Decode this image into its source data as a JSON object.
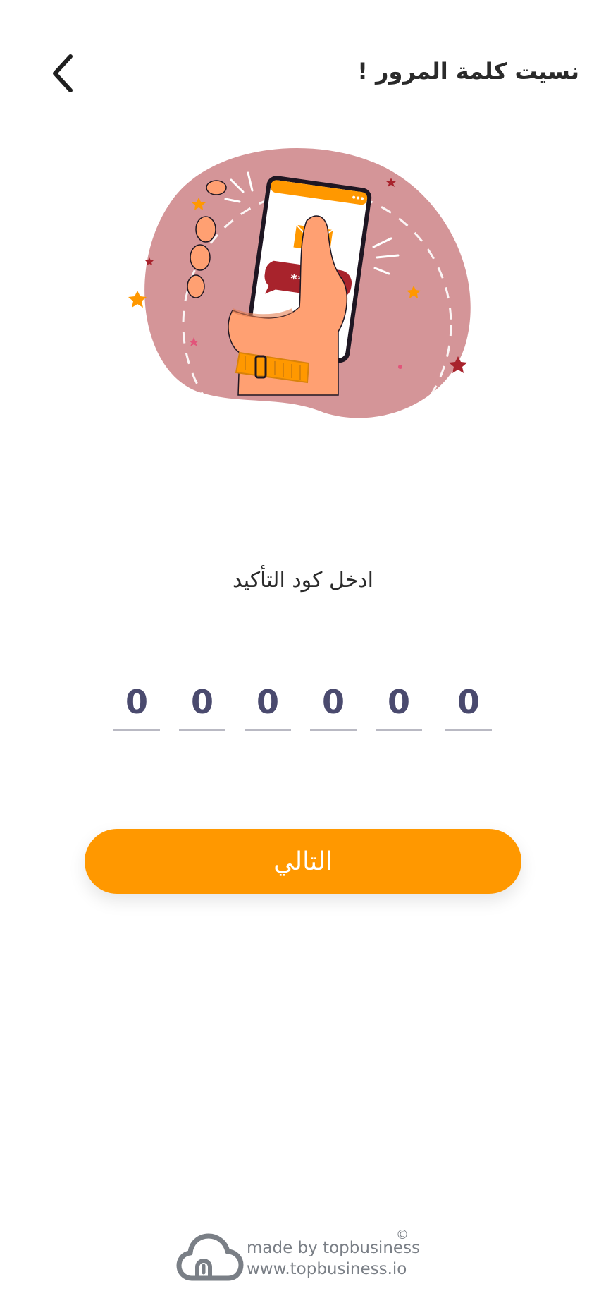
{
  "header": {
    "title": "نسيت كلمة المرور !",
    "back_icon": "chevron-left-icon"
  },
  "illustration": {
    "screen_message": "******"
  },
  "verification": {
    "instruction": "ادخل كود التأكيد",
    "digits": [
      "0",
      "0",
      "0",
      "0",
      "0",
      "0"
    ]
  },
  "actions": {
    "next_label": "التالي"
  },
  "footer": {
    "made_by": "made by topbusiness",
    "website": "www.topbusiness.io",
    "copyright_symbol": "©"
  },
  "colors": {
    "accent": "#ff9800",
    "blob": "#d49598",
    "digit": "#4a4a6e",
    "message_bubble": "#a8232c"
  }
}
